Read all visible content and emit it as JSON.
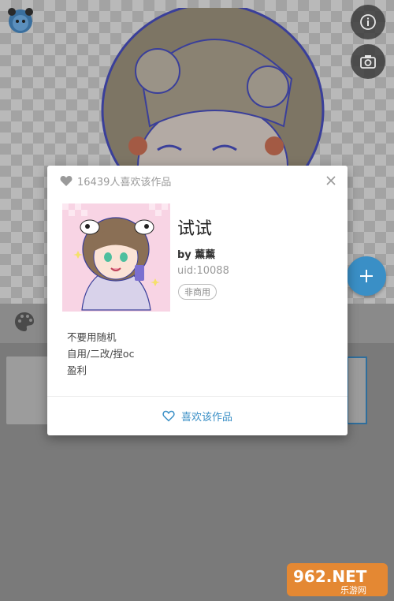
{
  "dialog": {
    "likes_count": "16439人喜欢该作品",
    "title": "试试",
    "author": "by 薰薰",
    "uid": "uid:10088",
    "license": "非商用",
    "description": [
      "不要用随机",
      "自用/二改/捏oc",
      "盈利"
    ],
    "like_button": "喜欢该作品"
  },
  "colors": {
    "accent": "#3a8fc6",
    "dialog_bg": "#ffffff",
    "overlay": "#7a7a7a"
  },
  "icons": {
    "app_logo": "panda-logo-icon",
    "info": "info-icon",
    "camera": "camera-icon",
    "add": "plus-icon",
    "palette": "palette-icon",
    "heart_header": "heart-filled-icon",
    "close": "close-icon",
    "heart_footer": "heart-outline-icon"
  },
  "watermark": {
    "brand": "962.NET",
    "tagline": "乐游网"
  }
}
